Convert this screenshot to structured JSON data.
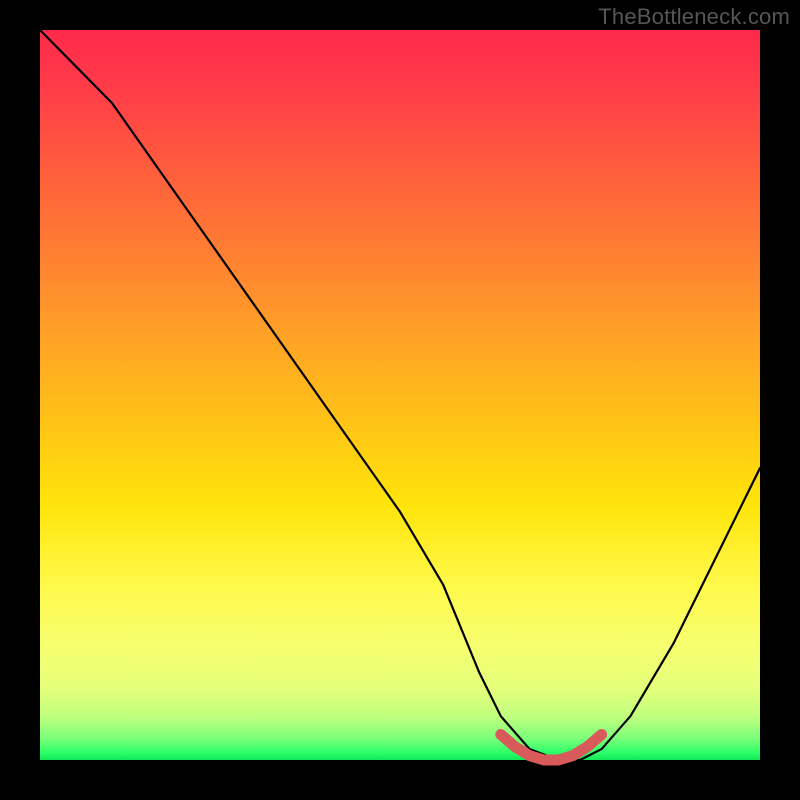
{
  "watermark": "TheBottleneck.com",
  "chart_data": {
    "type": "line",
    "title": "",
    "xlabel": "",
    "ylabel": "",
    "xlim": [
      0,
      100
    ],
    "ylim": [
      0,
      100
    ],
    "series": [
      {
        "name": "bottleneck-curve",
        "x": [
          0,
          4,
          10,
          20,
          30,
          40,
          50,
          56,
          61,
          64,
          68,
          72,
          75,
          78,
          82,
          88,
          94,
          100
        ],
        "y": [
          100,
          96,
          90,
          76,
          62,
          48,
          34,
          24,
          12,
          6,
          1.5,
          0,
          0,
          1.5,
          6,
          16,
          28,
          40
        ]
      }
    ],
    "highlight_segment": {
      "name": "bottom-highlight",
      "x": [
        64,
        66,
        68,
        70,
        72,
        74,
        76,
        78
      ],
      "y": [
        3.5,
        1.8,
        0.6,
        0,
        0,
        0.6,
        1.8,
        3.5
      ]
    },
    "gradient_stops": [
      {
        "pos": 0,
        "color": "#ff2a4b"
      },
      {
        "pos": 30,
        "color": "#ff7d33"
      },
      {
        "pos": 60,
        "color": "#ffe40a"
      },
      {
        "pos": 85,
        "color": "#e6ff7a"
      },
      {
        "pos": 100,
        "color": "#11e858"
      }
    ]
  }
}
